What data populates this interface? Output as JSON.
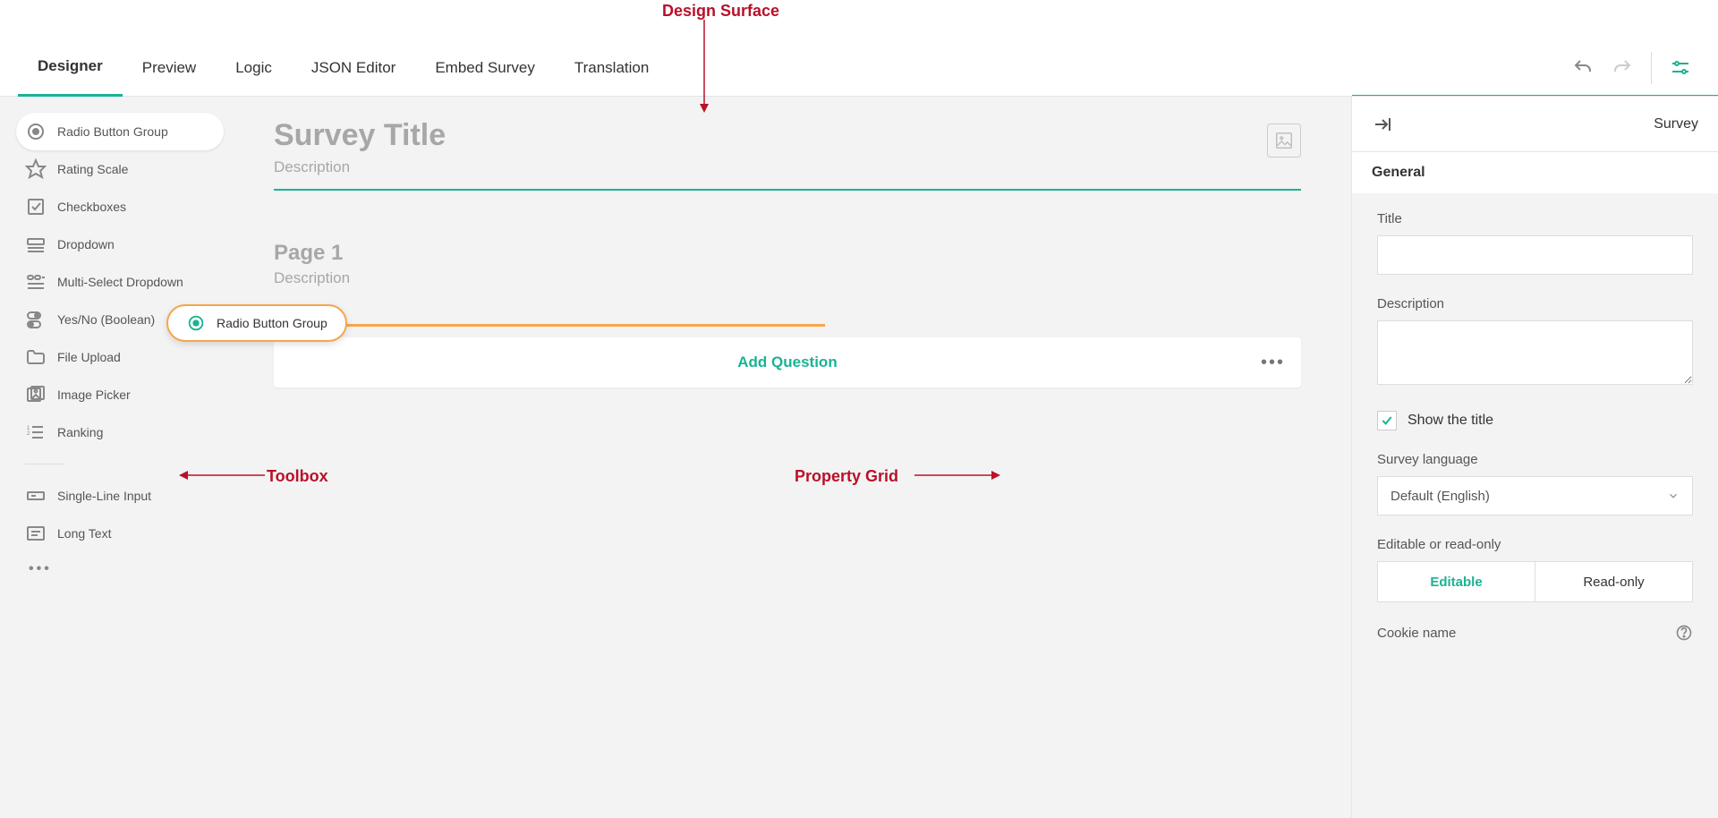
{
  "annotations": {
    "design_surface": "Design Surface",
    "toolbox": "Toolbox",
    "property_grid": "Property Grid"
  },
  "top_nav": {
    "tabs": [
      "Designer",
      "Preview",
      "Logic",
      "JSON Editor",
      "Embed Survey",
      "Translation"
    ],
    "active_tab": "Designer"
  },
  "toolbox": {
    "items": [
      {
        "label": "Radio Button Group",
        "icon": "radio",
        "active": true
      },
      {
        "label": "Rating Scale",
        "icon": "star"
      },
      {
        "label": "Checkboxes",
        "icon": "checkbox"
      },
      {
        "label": "Dropdown",
        "icon": "dropdown"
      },
      {
        "label": "Multi-Select Dropdown",
        "icon": "multiselect"
      },
      {
        "label": "Yes/No (Boolean)",
        "icon": "toggle"
      },
      {
        "label": "File Upload",
        "icon": "folder"
      },
      {
        "label": "Image Picker",
        "icon": "image"
      },
      {
        "label": "Ranking",
        "icon": "ranking"
      }
    ],
    "items2": [
      {
        "label": "Single-Line Input",
        "icon": "text"
      },
      {
        "label": "Long Text",
        "icon": "longtext"
      }
    ]
  },
  "drag_ghost": {
    "label": "Radio Button Group"
  },
  "surface": {
    "survey_title_placeholder": "Survey Title",
    "survey_description_placeholder": "Description",
    "page_title": "Page 1",
    "page_description": "Description",
    "add_question": "Add Question"
  },
  "prop_grid": {
    "object_type": "Survey",
    "section": "General",
    "fields": {
      "title_label": "Title",
      "title_value": "",
      "description_label": "Description",
      "description_value": "",
      "show_title_label": "Show the title",
      "show_title_checked": true,
      "language_label": "Survey language",
      "language_value": "Default (English)",
      "mode_label": "Editable or read-only",
      "mode_options": [
        "Editable",
        "Read-only"
      ],
      "mode_value": "Editable",
      "cookie_label": "Cookie name"
    }
  }
}
